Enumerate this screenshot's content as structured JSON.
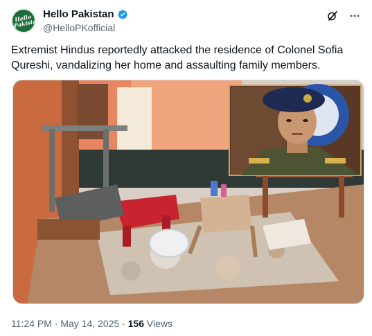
{
  "account": {
    "display_name": "Hello Pakistan",
    "handle": "@HelloPKofficial",
    "avatar_text": "Hello Pakistan"
  },
  "icons": {
    "verified": "verified-badge-icon",
    "grok": "grok-icon",
    "more": "more-options-icon"
  },
  "tweet": {
    "text": "Extremist Hindus reportedly attacked the residence of Colonel Sofia Qureshi, vandalizing her home and assaulting family members."
  },
  "meta": {
    "time": "11:24 PM",
    "separator": "·",
    "date": "May 14, 2025",
    "views_count": "156",
    "views_label": "Views"
  },
  "colors": {
    "verified": "#1d9bf0",
    "secondary_text": "#536471",
    "avatar_bg": "#1f6b3a"
  }
}
